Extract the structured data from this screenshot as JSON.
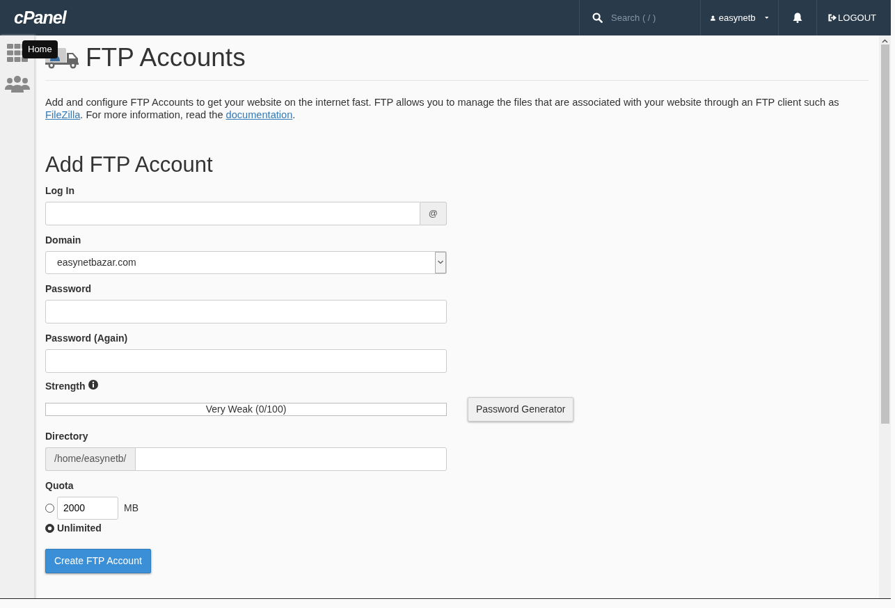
{
  "header": {
    "logo": "cPanel",
    "search": {
      "placeholder": "Search ( / )"
    },
    "user": "easynetb",
    "logout": "LOGOUT"
  },
  "sidebar": {
    "tooltip": "Home"
  },
  "page": {
    "title": "FTP Accounts",
    "description": [
      {
        "kind": "text",
        "text": "Add and configure FTP Accounts to get your website on the internet fast. FTP allows you to manage the files that are associated with your website through an FTP client such as "
      },
      {
        "kind": "link",
        "text": "FileZilla"
      },
      {
        "kind": "text",
        "text": ". For more information, read the "
      },
      {
        "kind": "link",
        "text": "documentation"
      },
      {
        "kind": "text",
        "text": "."
      }
    ]
  },
  "form": {
    "title": "Add FTP Account",
    "fields": [
      {
        "kind": "addon-after",
        "label": "Log In",
        "addon": "@"
      },
      {
        "kind": "select",
        "label": "Domain",
        "value": "easynetbazar.com"
      },
      {
        "kind": "password",
        "label": "Password"
      },
      {
        "kind": "password",
        "label": "Password (Again)"
      },
      {
        "kind": "strength",
        "label": "Strength",
        "level": 0,
        "reading": "Very Weak (0/100)",
        "button": "Password Generator"
      },
      {
        "kind": "prefix",
        "label": "Directory",
        "addon": "/home/easynetb/"
      },
      {
        "kind": "quota",
        "label": "Quota",
        "options": [
          {
            "kind": "amount",
            "value": "2000",
            "unit": "MB",
            "selected": false
          },
          {
            "kind": "plain",
            "text": "Unlimited",
            "selected": true
          }
        ]
      }
    ],
    "submit": "Create FTP Account"
  }
}
